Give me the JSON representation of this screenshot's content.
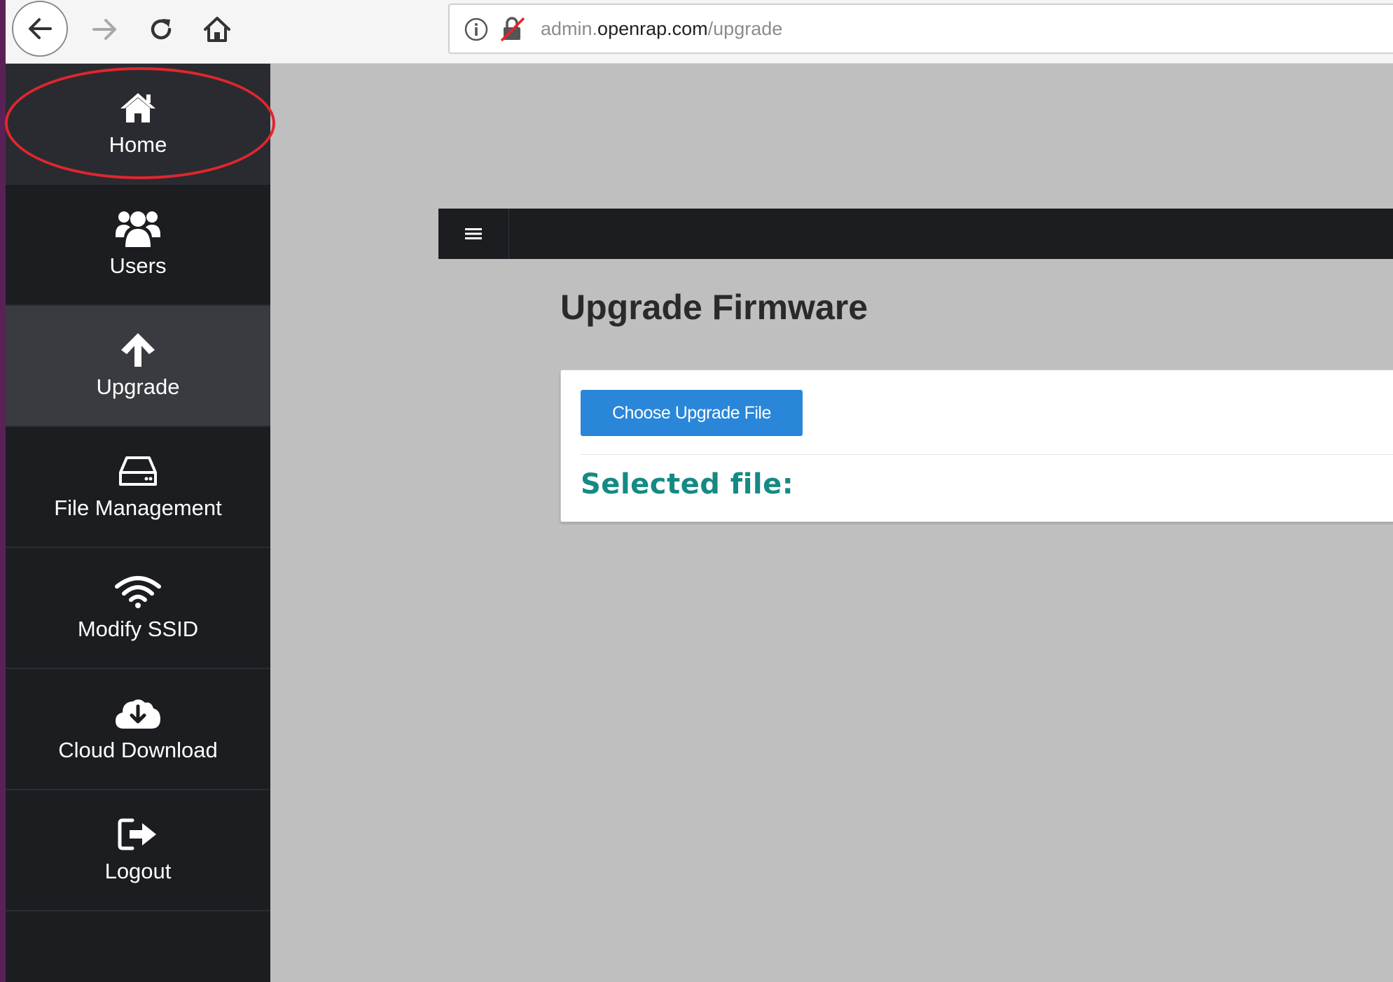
{
  "browser": {
    "url_prefix": "admin.",
    "url_domain": "openrap.com",
    "url_path": "/upgrade"
  },
  "sidebar": {
    "items": [
      {
        "label": "Home",
        "icon": "home-icon"
      },
      {
        "label": "Users",
        "icon": "users-icon"
      },
      {
        "label": "Upgrade",
        "icon": "arrow-up-icon"
      },
      {
        "label": "File Management",
        "icon": "hard-drive-icon"
      },
      {
        "label": "Modify SSID",
        "icon": "wifi-icon"
      },
      {
        "label": "Cloud Download",
        "icon": "cloud-download-icon"
      },
      {
        "label": "Logout",
        "icon": "sign-out-icon"
      }
    ],
    "active_index": 2
  },
  "main": {
    "title": "Upgrade Firmware",
    "choose_button_label": "Choose Upgrade File",
    "selected_file_label": "Selected file:"
  },
  "colors": {
    "sidebar_bg": "#1c1d21",
    "page_bg": "#bfbfbf",
    "button_blue": "#2a86d8",
    "selected_teal": "#158a84",
    "annotation_red": "#e0262f"
  }
}
